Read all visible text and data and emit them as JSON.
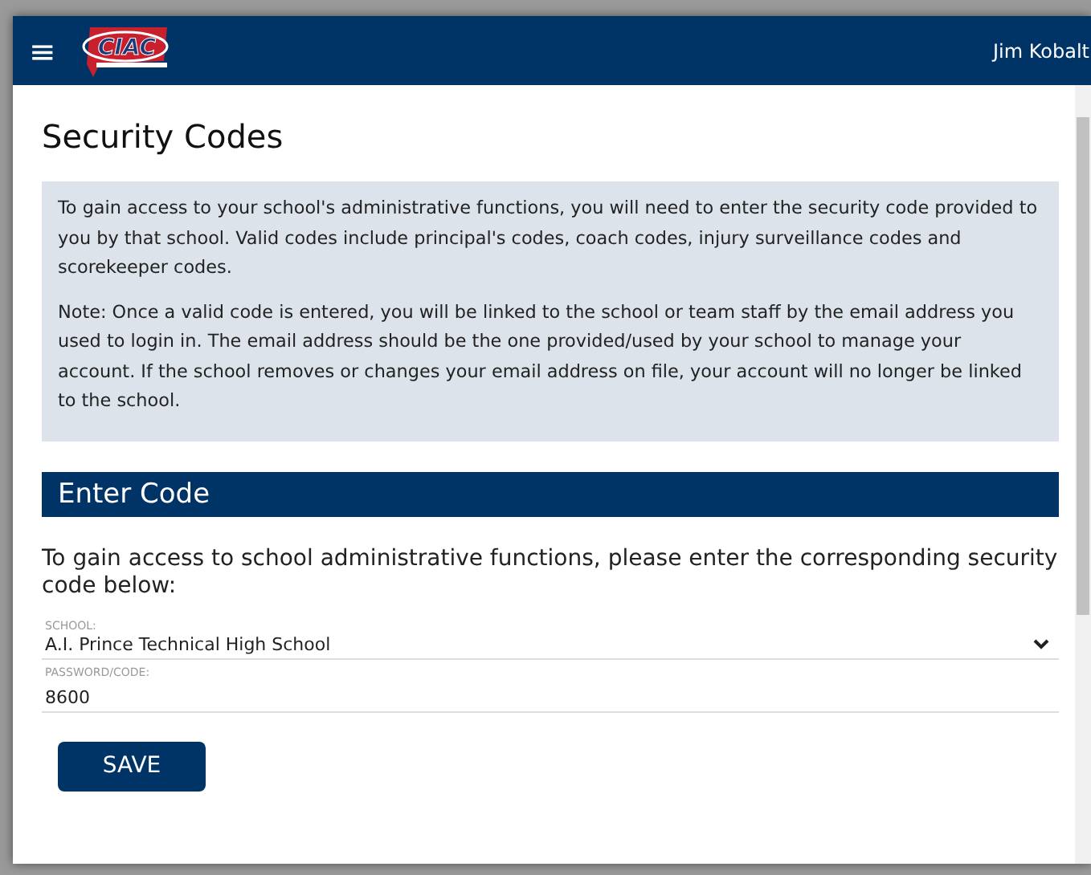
{
  "header": {
    "menu_icon": "≡",
    "logo_text": "CIAC",
    "user_name": "Jim Kobalt"
  },
  "page_title": "Security Codes",
  "info_paragraphs": [
    "To gain access to your school's administrative functions, you will need to enter the security code provided to you by that school. Valid codes include principal's codes, coach codes, injury surveillance codes and scorekeeper codes.",
    "Note: Once a valid code is entered, you will be linked to the school or team staff by the email address you used to login in. The email address should be the one provided/used by your school to manage your account. If the school removes or changes your email address on file, your account will no longer be linked to the school."
  ],
  "section_title": "Enter Code",
  "instructions": "To gain access to school administrative functions, please enter the corresponding security code below:",
  "fields": [
    {
      "kind": "select",
      "label": "SCHOOL:",
      "value": "A.I. Prince Technical High School"
    },
    {
      "kind": "text",
      "label": "PASSWORD/CODE:",
      "value": "8600"
    }
  ],
  "save_button": "SAVE"
}
